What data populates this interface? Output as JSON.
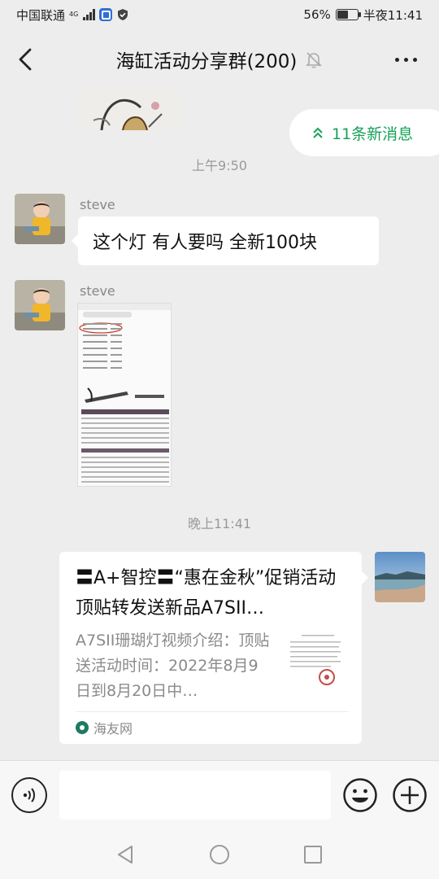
{
  "status_bar": {
    "carrier": "中国联通",
    "network": "4G",
    "battery_percent": "56%",
    "battery_level": 0.56,
    "time": "半夜11:41",
    "icons": [
      "signal-icon",
      "app-notification-icon",
      "shield-icon",
      "battery-icon"
    ]
  },
  "header": {
    "title": "海缸活动分享群(200)",
    "back_icon": "chevron-left-icon",
    "mute_icon": "bell-muted-icon",
    "more_icon": "more-dots-icon"
  },
  "new_messages": {
    "label": "11条新消息",
    "icon": "double-chevron-up-icon"
  },
  "messages": [
    {
      "type": "time",
      "text": "上午9:50"
    },
    {
      "type": "text",
      "sender": "steve",
      "text": "这个灯 有人要吗 全新100块"
    },
    {
      "type": "image",
      "sender": "steve"
    },
    {
      "type": "time",
      "text": "晚上11:41"
    },
    {
      "type": "link-card",
      "title": "〓A+智控〓“惠在金秋”促销活动顶贴转发送新品A7SII…",
      "description": "A7SII珊瑚灯视频介绍：顶贴送活动时间：2022年8月9日到8月20日中…",
      "source": "海友网"
    }
  ],
  "input_bar": {
    "voice_icon": "voice-icon",
    "emoji_icon": "smiley-icon",
    "plus_icon": "plus-circle-icon",
    "input_value": ""
  },
  "nav_bar": {
    "icons": [
      "back-triangle-icon",
      "home-circle-icon",
      "recents-square-icon"
    ]
  },
  "colors": {
    "background": "#ededed",
    "bubble": "#ffffff",
    "new_message_green": "#18a15a",
    "timestamp_gray": "#9a9a9a"
  }
}
